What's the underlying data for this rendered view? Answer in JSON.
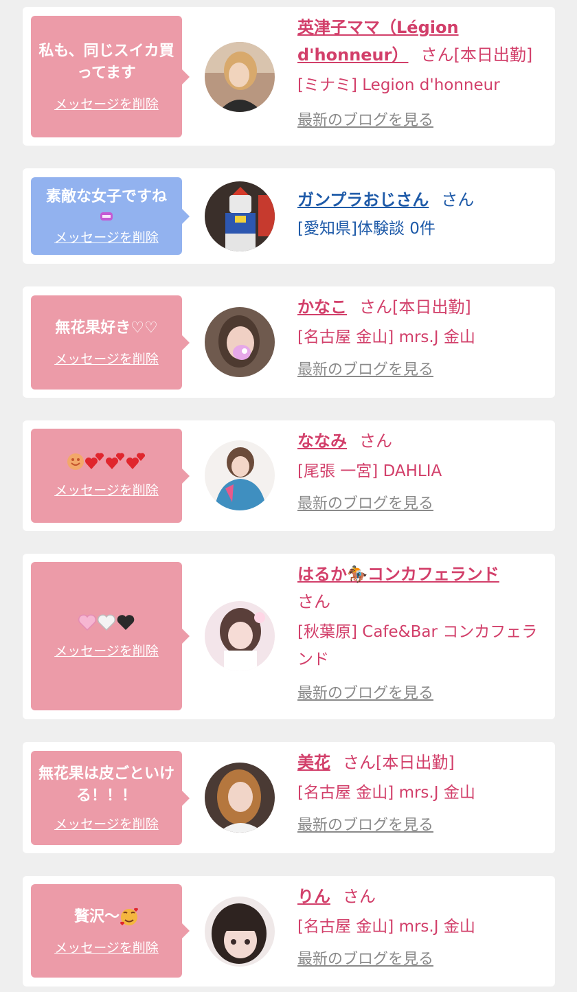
{
  "delete_label": "メッセージを削除",
  "blog_label": "最新のブログを見る",
  "colors": {
    "pink_bubble": "#ec9ba8",
    "blue_bubble": "#92b2ef",
    "pink_text": "#d23f6a",
    "blue_text": "#1e5aa8"
  },
  "items": [
    {
      "message": "私も、同じスイカ買ってます",
      "name": "英津子ママ（Légion d'honneur）",
      "suffix": "さん[本日出勤]",
      "shop": "[ミナミ] Legion d'honneur"
    },
    {
      "message": "素敵な女子ですね",
      "name": "ガンプラおじさん",
      "suffix": "さん",
      "shop": "[愛知県]体験談 0件"
    },
    {
      "message": "無花果好き♡♡",
      "name": "かなこ",
      "suffix": "さん[本日出勤]",
      "shop": "[名古屋 金山] mrs.J 金山"
    },
    {
      "message": "",
      "name": "ななみ",
      "suffix": "さん",
      "shop": "[尾張 一宮] DAHLIA"
    },
    {
      "message": "",
      "name": "はるか🏇コンカフェランド",
      "suffix": "さん",
      "shop": "[秋葉原] Cafe&Bar コンカフェランド"
    },
    {
      "message": "無花果は皮ごといける！！！",
      "name": "美花",
      "suffix": "さん[本日出勤]",
      "shop": "[名古屋 金山] mrs.J 金山"
    },
    {
      "message": "贅沢〜",
      "name": "りん",
      "suffix": "さん",
      "shop": "[名古屋 金山] mrs.J 金山"
    }
  ]
}
